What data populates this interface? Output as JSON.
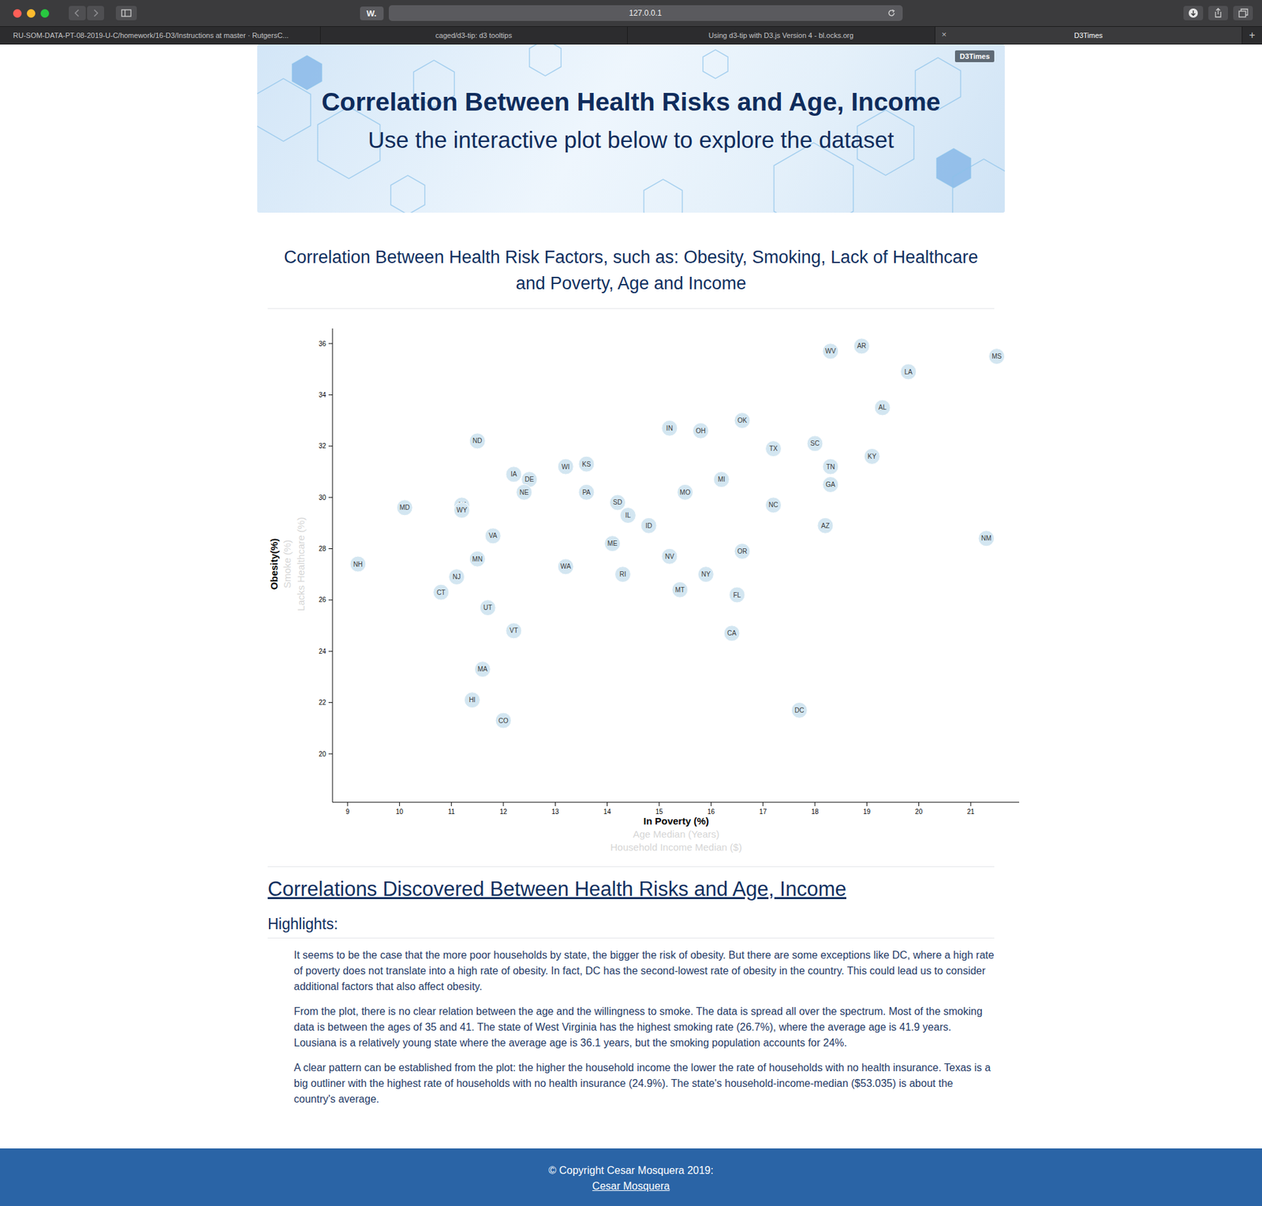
{
  "browser": {
    "reader_badge": "W.",
    "address": "127.0.0.1",
    "new_tab": "+",
    "tabs": [
      {
        "label": "RU-SOM-DATA-PT-08-2019-U-C/homework/16-D3/Instructions at master · RutgersC...",
        "selected": false,
        "close": ""
      },
      {
        "label": "caged/d3-tip: d3 tooltips",
        "selected": false,
        "close": ""
      },
      {
        "label": "Using d3-tip with D3.js Version 4 - bl.ocks.org",
        "selected": false,
        "close": ""
      },
      {
        "label": "D3Times",
        "selected": true,
        "close": "×"
      }
    ]
  },
  "banner": {
    "tag": "D3Times",
    "title": "Correlation Between Health Risks and Age, Income",
    "subtitle": "Use the interactive plot below to explore the dataset"
  },
  "chart": {
    "title": "Correlation Between Health Risk Factors, such as: Obesity, Smoking, Lack of Healthcare and Poverty, Age and Income",
    "x_ticks": [
      "9",
      "10",
      "11",
      "12",
      "13",
      "14",
      "15",
      "16",
      "17",
      "18",
      "19",
      "20",
      "21"
    ],
    "y_ticks": [
      "20",
      "22",
      "24",
      "26",
      "28",
      "30",
      "32",
      "34",
      "36"
    ],
    "x_labels": [
      {
        "label": "In Poverty (%)",
        "selected": true
      },
      {
        "label": "Age Median (Years)",
        "selected": false
      },
      {
        "label": "Household Income Median ($)",
        "selected": false
      }
    ],
    "y_labels": [
      {
        "label": "Obesity(%)",
        "selected": true
      },
      {
        "label": "Smoke (%)",
        "selected": false
      },
      {
        "label": "Lacks Healthcare (%)",
        "selected": false
      }
    ],
    "points": [
      {
        "abbr": "NH",
        "poverty": 9.2,
        "obesity": 27.4
      },
      {
        "abbr": "MD",
        "poverty": 10.1,
        "obesity": 29.6
      },
      {
        "abbr": "CT",
        "poverty": 10.8,
        "obesity": 26.3
      },
      {
        "abbr": "NJ",
        "poverty": 11.1,
        "obesity": 26.9
      },
      {
        "abbr": "AK",
        "poverty": 11.2,
        "obesity": 29.7
      },
      {
        "abbr": "WY",
        "poverty": 11.2,
        "obesity": 29.5
      },
      {
        "abbr": "MN",
        "poverty": 11.5,
        "obesity": 27.6
      },
      {
        "abbr": "ND",
        "poverty": 11.5,
        "obesity": 32.2
      },
      {
        "abbr": "HI",
        "poverty": 11.4,
        "obesity": 22.1
      },
      {
        "abbr": "MA",
        "poverty": 11.6,
        "obesity": 23.3
      },
      {
        "abbr": "UT",
        "poverty": 11.7,
        "obesity": 25.7
      },
      {
        "abbr": "VA",
        "poverty": 11.8,
        "obesity": 28.5
      },
      {
        "abbr": "CO",
        "poverty": 12.0,
        "obesity": 21.3
      },
      {
        "abbr": "VT",
        "poverty": 12.2,
        "obesity": 24.8
      },
      {
        "abbr": "IA",
        "poverty": 12.2,
        "obesity": 30.9
      },
      {
        "abbr": "DE",
        "poverty": 12.5,
        "obesity": 30.7
      },
      {
        "abbr": "NE",
        "poverty": 12.4,
        "obesity": 30.2
      },
      {
        "abbr": "WI",
        "poverty": 13.2,
        "obesity": 31.2
      },
      {
        "abbr": "WA",
        "poverty": 13.2,
        "obesity": 27.3
      },
      {
        "abbr": "KS",
        "poverty": 13.6,
        "obesity": 31.3
      },
      {
        "abbr": "PA",
        "poverty": 13.6,
        "obesity": 30.2
      },
      {
        "abbr": "ME",
        "poverty": 14.1,
        "obesity": 28.2
      },
      {
        "abbr": "SD",
        "poverty": 14.2,
        "obesity": 29.8
      },
      {
        "abbr": "RI",
        "poverty": 14.3,
        "obesity": 27.0
      },
      {
        "abbr": "IL",
        "poverty": 14.4,
        "obesity": 29.3
      },
      {
        "abbr": "ID",
        "poverty": 14.8,
        "obesity": 28.9
      },
      {
        "abbr": "IN",
        "poverty": 15.2,
        "obesity": 32.7
      },
      {
        "abbr": "NV",
        "poverty": 15.2,
        "obesity": 27.7
      },
      {
        "abbr": "MT",
        "poverty": 15.4,
        "obesity": 26.4
      },
      {
        "abbr": "MO",
        "poverty": 15.5,
        "obesity": 30.2
      },
      {
        "abbr": "OH",
        "poverty": 15.8,
        "obesity": 32.6
      },
      {
        "abbr": "NY",
        "poverty": 15.9,
        "obesity": 27.0
      },
      {
        "abbr": "MI",
        "poverty": 16.2,
        "obesity": 30.7
      },
      {
        "abbr": "CA",
        "poverty": 16.4,
        "obesity": 24.7
      },
      {
        "abbr": "FL",
        "poverty": 16.5,
        "obesity": 26.2
      },
      {
        "abbr": "OR",
        "poverty": 16.6,
        "obesity": 27.9
      },
      {
        "abbr": "OK",
        "poverty": 16.6,
        "obesity": 33.0
      },
      {
        "abbr": "NC",
        "poverty": 17.2,
        "obesity": 29.7
      },
      {
        "abbr": "TX",
        "poverty": 17.2,
        "obesity": 31.9
      },
      {
        "abbr": "DC",
        "poverty": 17.7,
        "obesity": 21.7
      },
      {
        "abbr": "SC",
        "poverty": 18.0,
        "obesity": 32.1
      },
      {
        "abbr": "AZ",
        "poverty": 18.2,
        "obesity": 28.9
      },
      {
        "abbr": "WV",
        "poverty": 18.3,
        "obesity": 35.7
      },
      {
        "abbr": "GA",
        "poverty": 18.3,
        "obesity": 30.5
      },
      {
        "abbr": "TN",
        "poverty": 18.3,
        "obesity": 31.2
      },
      {
        "abbr": "AR",
        "poverty": 18.9,
        "obesity": 35.9
      },
      {
        "abbr": "KY",
        "poverty": 19.1,
        "obesity": 31.6
      },
      {
        "abbr": "AL",
        "poverty": 19.3,
        "obesity": 33.5
      },
      {
        "abbr": "LA",
        "poverty": 19.8,
        "obesity": 34.9
      },
      {
        "abbr": "NM",
        "poverty": 21.3,
        "obesity": 28.4
      },
      {
        "abbr": "MS",
        "poverty": 21.5,
        "obesity": 35.5
      }
    ]
  },
  "highlights": {
    "heading": "Correlations Discovered Between Health Risks and Age, Income",
    "subheading": "Highlights:",
    "paragraphs": [
      "It seems to be the case that the more poor households by state, the bigger the risk of obesity. But there are some exceptions like DC, where a high rate of poverty does not translate into a high rate of obesity. In fact, DC has the second-lowest rate of obesity in the country. This could lead us to consider additional factors that also affect obesity.",
      "From the plot, there is no clear relation between the age and the willingness to smoke. The data is spread all over the spectrum. Most of the smoking data is between the ages of 35 and 41. The state of West Virginia has the highest smoking rate (26.7%), where the average age is 41.9 years. Lousiana is a relatively young state where the average age is 36.1 years, but the smoking population accounts for 24%.",
      "A clear pattern can be established from the plot: the higher the household income the lower the rate of households with no health insurance. Texas is a big outliner with the highest rate of households with no health insurance (24.9%). The state's household-income-median ($53.035) is about the country's average."
    ]
  },
  "footer": {
    "copyright": "© Copyright Cesar Mosquera 2019:",
    "link": "Cesar Mosquera"
  }
}
